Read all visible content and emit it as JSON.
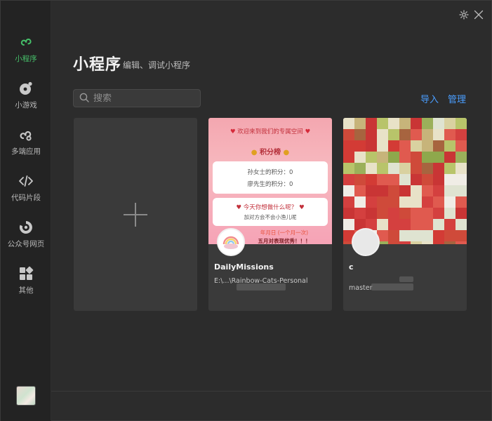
{
  "sidebar": {
    "items": [
      {
        "label": "小程序",
        "icon": "miniprogram-icon",
        "active": true
      },
      {
        "label": "小游戏",
        "icon": "minigame-icon",
        "active": false
      },
      {
        "label": "多端应用",
        "icon": "multiplatform-icon",
        "active": false
      },
      {
        "label": "代码片段",
        "icon": "code-snippet-icon",
        "active": false
      },
      {
        "label": "公众号网页",
        "icon": "official-account-icon",
        "active": false
      },
      {
        "label": "其他",
        "icon": "other-icon",
        "active": false
      }
    ],
    "accent_color": "#46c06a"
  },
  "header": {
    "title": "小程序",
    "subtitle": "编辑、调试小程序"
  },
  "search": {
    "placeholder": "搜索"
  },
  "actions": {
    "import_label": "导入",
    "manage_label": "管理",
    "link_color": "#4a9eff"
  },
  "projects": [
    {
      "name": "DailyMissions",
      "description": "E:\\...\\Rainbow-Cats-Personal",
      "cover": {
        "welcome": "欢迎来到我们的专属空间",
        "ranking_title": "积分榜",
        "score_line_1": "孙女士的积分：0",
        "score_line_2": "廖先生的积分：0",
        "question": "今天你想做什么呢？",
        "hint": "加对方会不会小渔儿呢",
        "footer": "年月日 (一个月一次)",
        "footer_2": "五月对表现优秀！！！"
      }
    },
    {
      "name": "c",
      "description": "master"
    }
  ]
}
